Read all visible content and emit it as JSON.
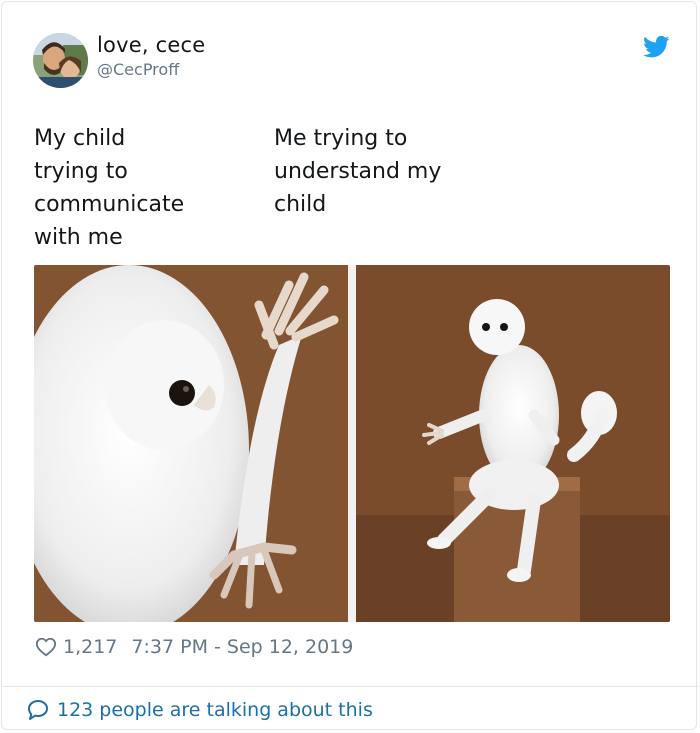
{
  "tweet": {
    "author_name": "love, cece",
    "author_handle": "@CecProff",
    "caption_left": "My child\ntrying to\ncommunicate\nwith me",
    "caption_right": "Me trying to\n understand my\nchild",
    "likes": "1,217",
    "timestamp": "7:37 PM - Sep 12, 2019",
    "talking": "123 people are talking about this"
  },
  "icons": {
    "bird": "twitter-bird-icon",
    "heart": "heart-icon",
    "bubble": "speech-bubble-icon"
  },
  "colors": {
    "brand": "#1da1f2",
    "link": "#1b6fa8",
    "muted": "#657786",
    "border": "#e1e8ed"
  }
}
